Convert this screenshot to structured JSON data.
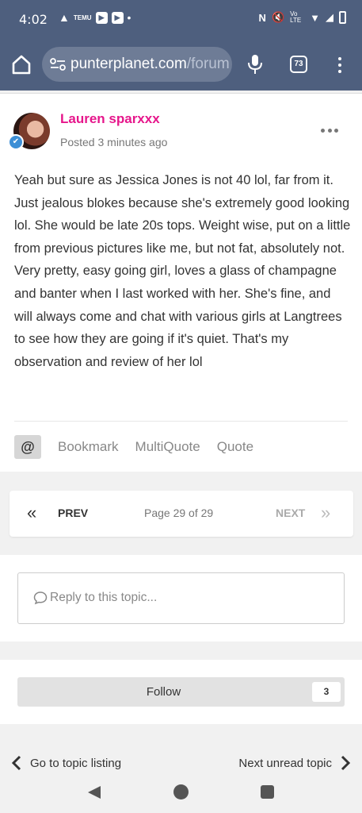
{
  "status_bar": {
    "time": "4:02",
    "left_icons": [
      "warning-icon",
      "temu-icon",
      "play-store-icon",
      "play-icon",
      "dot-icon"
    ],
    "right_icons": [
      "nfc-icon",
      "mute-icon",
      "volte-icon",
      "wifi-icon",
      "signal-icon",
      "battery-icon"
    ],
    "volte_label": "Vo LTE"
  },
  "browser": {
    "url_domain": "punterplanet.com",
    "url_path": "/forum",
    "tab_count": "73"
  },
  "post": {
    "author": "Lauren sparxxx",
    "posted": "Posted 3 minutes ago",
    "body": "Yeah but sure as Jessica Jones is not 40 lol, far from it. Just jealous blokes because she's extremely good looking lol. She would be late 20s tops. Weight wise, put on a little from previous pictures like me, but not fat, absolutely not. Very pretty, easy going girl, loves a glass of champagne and banter when I last worked with her. She's fine, and will always come and chat with various girls at Langtrees to see how they are going if it's quiet. That's my observation and review of her lol",
    "mention_label": "@",
    "actions": {
      "bookmark": "Bookmark",
      "multiquote": "MultiQuote",
      "quote": "Quote"
    }
  },
  "pagination": {
    "prev": "PREV",
    "page_info": "Page 29 of 29",
    "next": "NEXT"
  },
  "reply": {
    "placeholder": "Reply to this topic..."
  },
  "follow": {
    "label": "Follow",
    "count": "3"
  },
  "topic_nav": {
    "back": "Go to topic listing",
    "next": "Next unread topic"
  },
  "colors": {
    "browser_bar": "#4e5f7e",
    "author": "#e6168b",
    "badge": "#3d8fd6"
  }
}
